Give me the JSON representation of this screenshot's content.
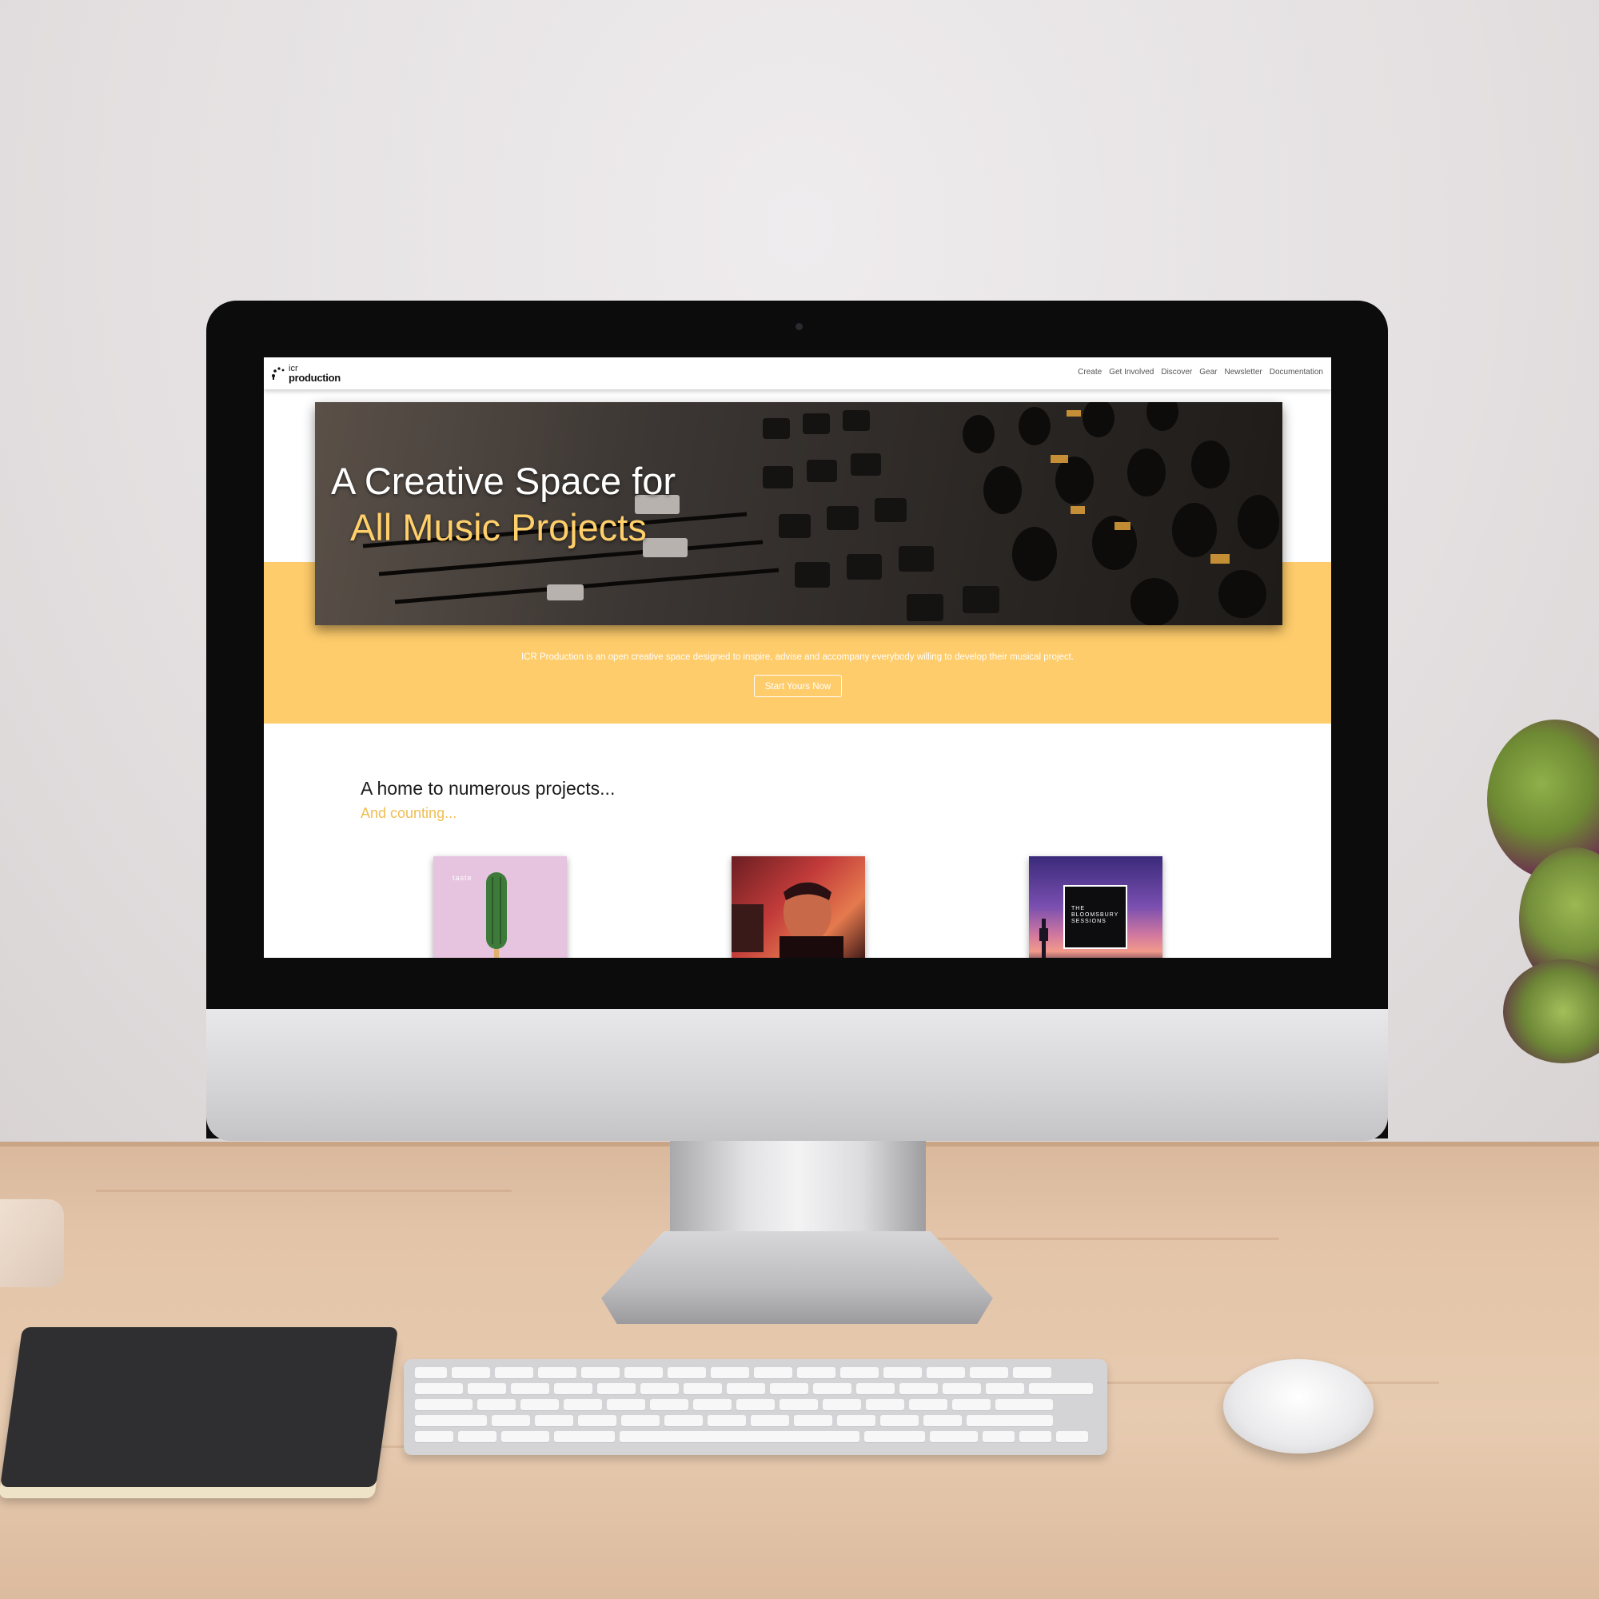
{
  "site": {
    "logo": {
      "small": "icr",
      "big": "production"
    },
    "nav": [
      "Create",
      "Get Involved",
      "Discover",
      "Gear",
      "Newsletter",
      "Documentation"
    ]
  },
  "hero": {
    "title_line1": "A Creative Space for",
    "title_line2": "All Music Projects",
    "tagline": "ICR Production is an open creative space designed to inspire, advise and accompany everybody willing to develop their musical project.",
    "cta": "Start Yours Now"
  },
  "projects": {
    "title": "A home to numerous projects...",
    "subtitle": "And counting...",
    "cards": [
      {
        "text": "taste"
      },
      {
        "text": ""
      },
      {
        "text": "THE BLOOMSBURY SESSIONS"
      }
    ]
  },
  "colors": {
    "accent": "#fecc6b",
    "accent_text": "#f0bd52",
    "hero_title_highlight": "#ffcf6a"
  }
}
